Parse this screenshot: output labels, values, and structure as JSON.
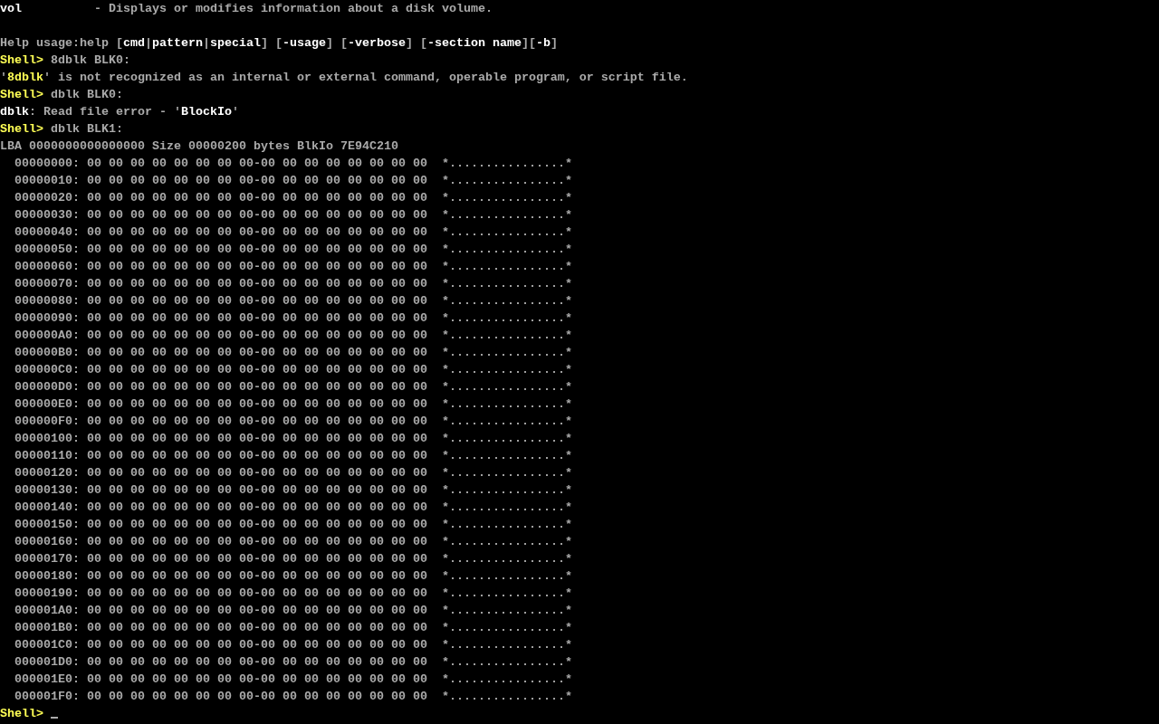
{
  "console": {
    "lines": [
      {
        "kind": "text",
        "segments": [
          {
            "text": "vol",
            "kind": "bright"
          },
          {
            "text": "          - Displays or modifies information about a disk volume.",
            "kind": "normal"
          }
        ]
      },
      {
        "kind": "blank"
      },
      {
        "kind": "text",
        "segments": [
          {
            "text": "Help usage:help [",
            "kind": "normal"
          },
          {
            "text": "cmd",
            "kind": "bright"
          },
          {
            "text": "|",
            "kind": "normal"
          },
          {
            "text": "pattern",
            "kind": "bright"
          },
          {
            "text": "|",
            "kind": "normal"
          },
          {
            "text": "special",
            "kind": "bright"
          },
          {
            "text": "] [",
            "kind": "normal"
          },
          {
            "text": "-usage",
            "kind": "bright"
          },
          {
            "text": "] [",
            "kind": "normal"
          },
          {
            "text": "-verbose",
            "kind": "bright"
          },
          {
            "text": "] [",
            "kind": "normal"
          },
          {
            "text": "-section name",
            "kind": "bright"
          },
          {
            "text": "][",
            "kind": "normal"
          },
          {
            "text": "-b",
            "kind": "bright"
          },
          {
            "text": "]",
            "kind": "normal"
          }
        ]
      },
      {
        "kind": "text",
        "segments": [
          {
            "text": "Shell>",
            "kind": "prompt"
          },
          {
            "text": " 8dblk BLK0:",
            "kind": "normal"
          }
        ]
      },
      {
        "kind": "text",
        "segments": [
          {
            "text": "'",
            "kind": "normal"
          },
          {
            "text": "8dblk",
            "kind": "prompt"
          },
          {
            "text": "' is not recognized as an internal or external command, operable program, or script file.",
            "kind": "normal"
          }
        ]
      },
      {
        "kind": "text",
        "segments": [
          {
            "text": "Shell>",
            "kind": "prompt"
          },
          {
            "text": " dblk BLK0:",
            "kind": "normal"
          }
        ]
      },
      {
        "kind": "text",
        "segments": [
          {
            "text": "dblk",
            "kind": "bright"
          },
          {
            "text": ": Read file error - '",
            "kind": "normal"
          },
          {
            "text": "BlockIo",
            "kind": "bright"
          },
          {
            "text": "'",
            "kind": "normal"
          }
        ]
      },
      {
        "kind": "text",
        "segments": [
          {
            "text": "Shell>",
            "kind": "prompt"
          },
          {
            "text": " dblk BLK1:",
            "kind": "normal"
          }
        ]
      },
      {
        "kind": "text",
        "segments": [
          {
            "text": "LBA 0000000000000000 Size 00000200 bytes BlkIo 7E94C210",
            "kind": "normal"
          }
        ]
      }
    ],
    "hex_dump": [
      {
        "offset": "00000000:",
        "bytes": "00 00 00 00 00 00 00 00-00 00 00 00 00 00 00 00",
        "ascii": "*................*"
      },
      {
        "offset": "00000010:",
        "bytes": "00 00 00 00 00 00 00 00-00 00 00 00 00 00 00 00",
        "ascii": "*................*"
      },
      {
        "offset": "00000020:",
        "bytes": "00 00 00 00 00 00 00 00-00 00 00 00 00 00 00 00",
        "ascii": "*................*"
      },
      {
        "offset": "00000030:",
        "bytes": "00 00 00 00 00 00 00 00-00 00 00 00 00 00 00 00",
        "ascii": "*................*"
      },
      {
        "offset": "00000040:",
        "bytes": "00 00 00 00 00 00 00 00-00 00 00 00 00 00 00 00",
        "ascii": "*................*"
      },
      {
        "offset": "00000050:",
        "bytes": "00 00 00 00 00 00 00 00-00 00 00 00 00 00 00 00",
        "ascii": "*................*"
      },
      {
        "offset": "00000060:",
        "bytes": "00 00 00 00 00 00 00 00-00 00 00 00 00 00 00 00",
        "ascii": "*................*"
      },
      {
        "offset": "00000070:",
        "bytes": "00 00 00 00 00 00 00 00-00 00 00 00 00 00 00 00",
        "ascii": "*................*"
      },
      {
        "offset": "00000080:",
        "bytes": "00 00 00 00 00 00 00 00-00 00 00 00 00 00 00 00",
        "ascii": "*................*"
      },
      {
        "offset": "00000090:",
        "bytes": "00 00 00 00 00 00 00 00-00 00 00 00 00 00 00 00",
        "ascii": "*................*"
      },
      {
        "offset": "000000A0:",
        "bytes": "00 00 00 00 00 00 00 00-00 00 00 00 00 00 00 00",
        "ascii": "*................*"
      },
      {
        "offset": "000000B0:",
        "bytes": "00 00 00 00 00 00 00 00-00 00 00 00 00 00 00 00",
        "ascii": "*................*"
      },
      {
        "offset": "000000C0:",
        "bytes": "00 00 00 00 00 00 00 00-00 00 00 00 00 00 00 00",
        "ascii": "*................*"
      },
      {
        "offset": "000000D0:",
        "bytes": "00 00 00 00 00 00 00 00-00 00 00 00 00 00 00 00",
        "ascii": "*................*"
      },
      {
        "offset": "000000E0:",
        "bytes": "00 00 00 00 00 00 00 00-00 00 00 00 00 00 00 00",
        "ascii": "*................*"
      },
      {
        "offset": "000000F0:",
        "bytes": "00 00 00 00 00 00 00 00-00 00 00 00 00 00 00 00",
        "ascii": "*................*"
      },
      {
        "offset": "00000100:",
        "bytes": "00 00 00 00 00 00 00 00-00 00 00 00 00 00 00 00",
        "ascii": "*................*"
      },
      {
        "offset": "00000110:",
        "bytes": "00 00 00 00 00 00 00 00-00 00 00 00 00 00 00 00",
        "ascii": "*................*"
      },
      {
        "offset": "00000120:",
        "bytes": "00 00 00 00 00 00 00 00-00 00 00 00 00 00 00 00",
        "ascii": "*................*"
      },
      {
        "offset": "00000130:",
        "bytes": "00 00 00 00 00 00 00 00-00 00 00 00 00 00 00 00",
        "ascii": "*................*"
      },
      {
        "offset": "00000140:",
        "bytes": "00 00 00 00 00 00 00 00-00 00 00 00 00 00 00 00",
        "ascii": "*................*"
      },
      {
        "offset": "00000150:",
        "bytes": "00 00 00 00 00 00 00 00-00 00 00 00 00 00 00 00",
        "ascii": "*................*"
      },
      {
        "offset": "00000160:",
        "bytes": "00 00 00 00 00 00 00 00-00 00 00 00 00 00 00 00",
        "ascii": "*................*"
      },
      {
        "offset": "00000170:",
        "bytes": "00 00 00 00 00 00 00 00-00 00 00 00 00 00 00 00",
        "ascii": "*................*"
      },
      {
        "offset": "00000180:",
        "bytes": "00 00 00 00 00 00 00 00-00 00 00 00 00 00 00 00",
        "ascii": "*................*"
      },
      {
        "offset": "00000190:",
        "bytes": "00 00 00 00 00 00 00 00-00 00 00 00 00 00 00 00",
        "ascii": "*................*"
      },
      {
        "offset": "000001A0:",
        "bytes": "00 00 00 00 00 00 00 00-00 00 00 00 00 00 00 00",
        "ascii": "*................*"
      },
      {
        "offset": "000001B0:",
        "bytes": "00 00 00 00 00 00 00 00-00 00 00 00 00 00 00 00",
        "ascii": "*................*"
      },
      {
        "offset": "000001C0:",
        "bytes": "00 00 00 00 00 00 00 00-00 00 00 00 00 00 00 00",
        "ascii": "*................*"
      },
      {
        "offset": "000001D0:",
        "bytes": "00 00 00 00 00 00 00 00-00 00 00 00 00 00 00 00",
        "ascii": "*................*"
      },
      {
        "offset": "000001E0:",
        "bytes": "00 00 00 00 00 00 00 00-00 00 00 00 00 00 00 00",
        "ascii": "*................*"
      },
      {
        "offset": "000001F0:",
        "bytes": "00 00 00 00 00 00 00 00-00 00 00 00 00 00 00 00",
        "ascii": "*................*"
      }
    ],
    "prompt": {
      "text": "Shell>",
      "kind": "prompt"
    }
  }
}
